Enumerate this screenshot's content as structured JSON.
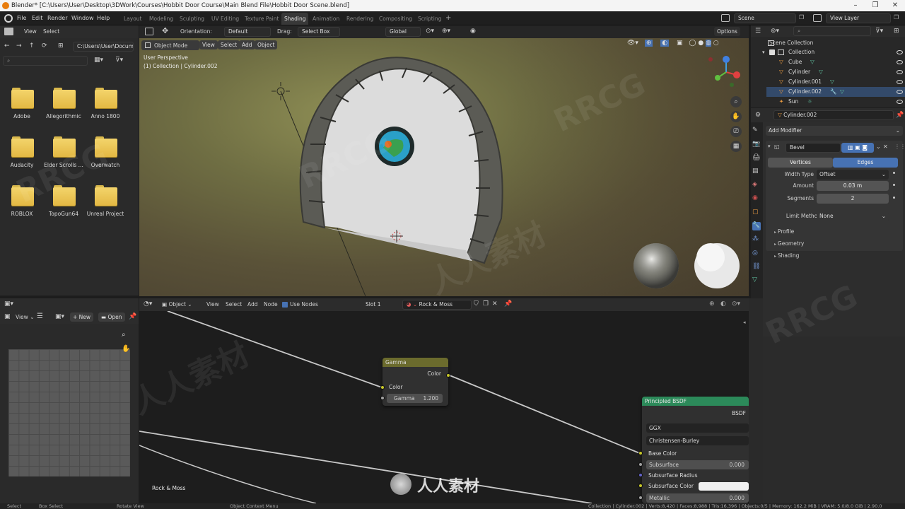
{
  "titlebar": {
    "title": "Blender* [C:\\Users\\User\\Desktop\\3DWork\\Courses\\Hobbit Door Course\\Main Blend File\\Hobbit Door Scene.blend]"
  },
  "menu": {
    "items": [
      "File",
      "Edit",
      "Render",
      "Window",
      "Help"
    ]
  },
  "workspaces": {
    "tabs": [
      "Layout",
      "Modeling",
      "Sculpting",
      "UV Editing",
      "Texture Paint",
      "Shading",
      "Animation",
      "Rendering",
      "Compositing",
      "Scripting"
    ],
    "active": "Shading"
  },
  "top_right": {
    "scene": "Scene",
    "view_layer": "View Layer"
  },
  "file_browser": {
    "header": {
      "view": "View",
      "select": "Select"
    },
    "path": "C:\\Users\\User\\Docum...",
    "folders": [
      "Adobe",
      "Allegorithmic",
      "Anno 1800",
      "Audacity",
      "Elder Scrolls ...",
      "Overwatch",
      "ROBLOX",
      "TopoGun64",
      "Unreal Project"
    ]
  },
  "viewport": {
    "orientation_label": "Orientation:",
    "orientation": "Default",
    "drag_label": "Drag:",
    "drag": "Select Box",
    "transform": "Global",
    "options": "Options",
    "mode": "Object Mode",
    "menu": [
      "View",
      "Select",
      "Add",
      "Object"
    ],
    "overlay_title": "User Perspective",
    "overlay_subtitle": "(1) Collection | Cylinder.002"
  },
  "outliner": {
    "scene_collection": "Scene Collection",
    "collection": "Collection",
    "objects": [
      "Cube",
      "Cylinder",
      "Cylinder.001",
      "Cylinder.002",
      "Sun"
    ]
  },
  "properties": {
    "object_name": "Cylinder.002",
    "add_modifier": "Add Modifier",
    "modifier_name": "Bevel",
    "tab_vertices": "Vertices",
    "tab_edges": "Edges",
    "width_type_label": "Width Type",
    "width_type": "Offset",
    "amount_label": "Amount",
    "amount": "0.03 m",
    "segments_label": "Segments",
    "segments": "2",
    "limit_method_label": "Limit Method",
    "limit_method": "None",
    "sections": [
      "Profile",
      "Geometry",
      "Shading"
    ]
  },
  "image_editor": {
    "view": "View",
    "new": "New",
    "open": "Open"
  },
  "node_editor": {
    "object": "Object",
    "menu": [
      "View",
      "Select",
      "Add",
      "Node"
    ],
    "use_nodes": "Use Nodes",
    "slot": "Slot 1",
    "material": "Rock & Moss",
    "material_label": "Rock & Moss",
    "gamma_node": {
      "title": "Gamma",
      "output": "Color",
      "input": "Color",
      "gamma_label": "Gamma",
      "gamma_value": "1.200"
    },
    "bsdf_node": {
      "title": "Principled BSDF",
      "output": "BSDF",
      "distribution": "GGX",
      "subsurface_method": "Christensen-Burley",
      "rows": [
        {
          "label": "Base Color",
          "value": ""
        },
        {
          "label": "Subsurface",
          "value": "0.000"
        },
        {
          "label": "Subsurface Radius",
          "value": ""
        },
        {
          "label": "Subsurface Color",
          "value": ""
        },
        {
          "label": "Metallic",
          "value": "0.000"
        }
      ]
    }
  },
  "statusbar": {
    "items": [
      "Select",
      "Box Select",
      "Rotate View",
      "Object Context Menu"
    ],
    "stats": "Collection | Cylinder.002 | Verts:8,420 | Faces:8,988 | Tris:16,396 | Objects:0/5 | Memory: 162.2 MiB | VRAM: 5.0/8.0 GiB | 2.90.0"
  },
  "watermarks": [
    "RRCG",
    "人人素材"
  ],
  "colors": {
    "accent": "#4772b3",
    "gamma_header": "#6b6b2d",
    "bsdf_header": "#2c8a5a",
    "folder": "#e8c55a"
  }
}
